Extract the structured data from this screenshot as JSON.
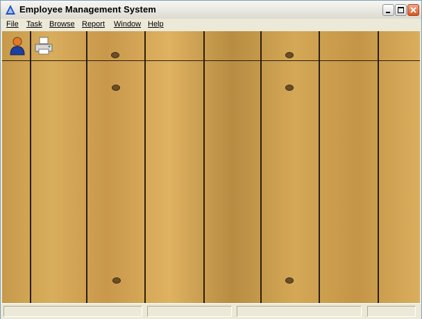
{
  "window": {
    "title": "Employee Management System"
  },
  "menu": [
    {
      "label": "File"
    },
    {
      "label": "Task"
    },
    {
      "label": "Browse"
    },
    {
      "label": "Report"
    },
    {
      "label": "Window"
    },
    {
      "label": "Help"
    }
  ],
  "toolbar": [
    {
      "icon": "user-icon",
      "name": "employee"
    },
    {
      "icon": "printer-icon",
      "name": "print"
    }
  ],
  "statusbar": {
    "panels": [
      "",
      "",
      "",
      ""
    ]
  }
}
